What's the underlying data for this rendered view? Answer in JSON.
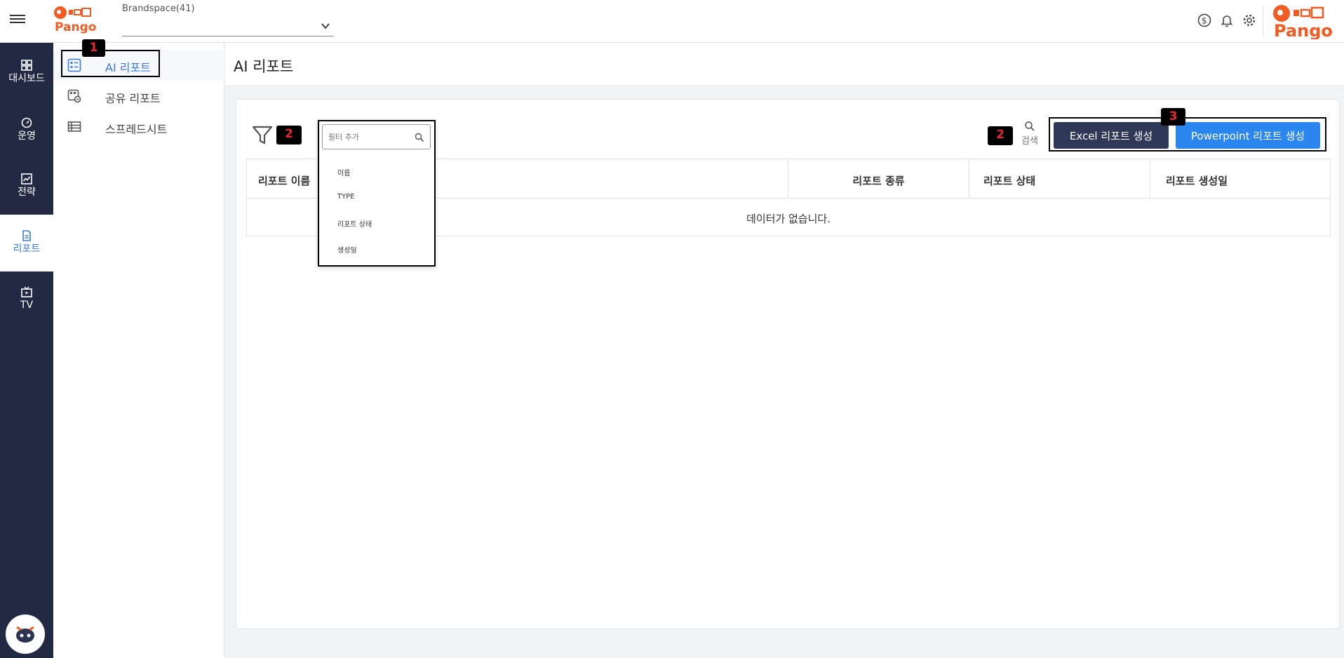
{
  "header": {
    "brand_label": "Brandspace(41)",
    "brand_select_value": "",
    "logo_text": "Pango"
  },
  "rail": {
    "items": [
      {
        "label": "대시보드",
        "icon": "dashboard-icon"
      },
      {
        "label": "운영",
        "icon": "gauge-icon"
      },
      {
        "label": "전략",
        "icon": "chart-icon"
      },
      {
        "label": "리포트",
        "icon": "document-icon",
        "active": true
      },
      {
        "label": "TV",
        "icon": "tv-icon"
      }
    ]
  },
  "subnav": {
    "items": [
      {
        "label": "AI 리포트",
        "icon": "report-list-icon",
        "active": true
      },
      {
        "label": "공유 리포트",
        "icon": "shared-report-icon"
      },
      {
        "label": "스프레드시트",
        "icon": "spreadsheet-icon"
      }
    ]
  },
  "page": {
    "title": "AI 리포트"
  },
  "toolbar": {
    "search_label": "검색",
    "excel_button": "Excel 리포트 생성",
    "ppt_button": "Powerpoint 리포트 생성"
  },
  "filter_dropdown": {
    "placeholder": "필터 추가",
    "options": [
      "이름",
      "TYPE",
      "리포트 상태",
      "생성일"
    ]
  },
  "table": {
    "columns": [
      "리포트 이름",
      "리포트 종류",
      "리포트 상태",
      "리포트 생성일"
    ],
    "empty_text": "데이터가 없습니다."
  },
  "annotations": [
    "1",
    "2",
    "2",
    "3"
  ],
  "colors": {
    "rail_bg": "#212a42",
    "accent": "#3b7ae0",
    "excel_btn": "#2f3957",
    "ppt_btn": "#2b86f0",
    "logo": "#f25c22",
    "badge_text": "#e8272f"
  }
}
